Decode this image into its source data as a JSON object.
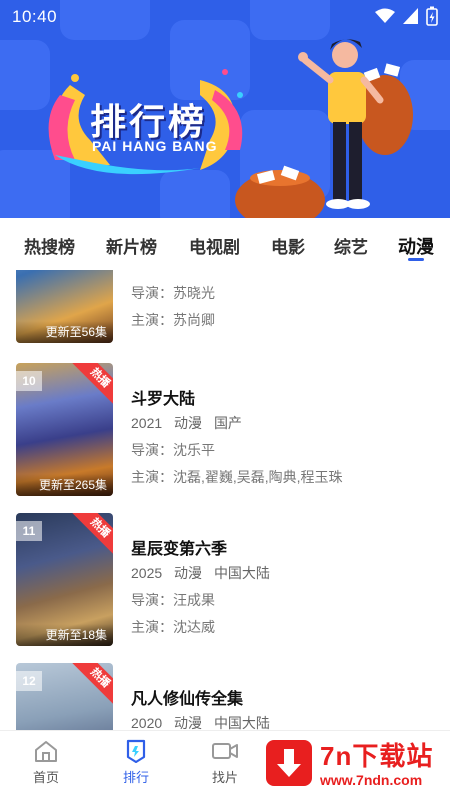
{
  "status_bar": {
    "time": "10:40"
  },
  "banner": {
    "title": "排行榜",
    "subtitle": "PAI HANG BANG"
  },
  "tabs": [
    {
      "label": "热搜榜",
      "active": false
    },
    {
      "label": "新片榜",
      "active": false
    },
    {
      "label": "电视剧",
      "active": false
    },
    {
      "label": "电影",
      "active": false
    },
    {
      "label": "综艺",
      "active": false
    },
    {
      "label": "动漫",
      "active": true
    }
  ],
  "items": [
    {
      "rank": "",
      "title": "",
      "year": "",
      "genre": "",
      "region": "",
      "director": "导演：苏晓光",
      "cast": "主演：苏尚卿",
      "update": "更新至56集",
      "hot": false
    },
    {
      "rank": "10",
      "title": "斗罗大陆",
      "year": "2021",
      "genre": "动漫",
      "region": "国产",
      "director": "导演：沈乐平",
      "cast": "主演：沈磊,翟巍,吴磊,陶典,程玉珠",
      "update": "更新至265集",
      "hot_label": "热播",
      "hot": true
    },
    {
      "rank": "11",
      "title": "星辰变第六季",
      "year": "2025",
      "genre": "动漫",
      "region": "中国大陆",
      "director": "导演：汪成果",
      "cast": "主演：沈达威",
      "update": "更新至18集",
      "hot_label": "热播",
      "hot": true
    },
    {
      "rank": "12",
      "title": "凡人修仙传全集",
      "year": "2020",
      "genre": "动漫",
      "region": "中国大陆",
      "director": "",
      "cast": "",
      "update": "",
      "hot_label": "热播",
      "hot": true
    }
  ],
  "bottom_nav": [
    {
      "label": "首页",
      "icon": "home-icon",
      "active": false
    },
    {
      "label": "排行",
      "icon": "ranking-icon",
      "active": true
    },
    {
      "label": "找片",
      "icon": "video-camera-icon",
      "active": false
    }
  ],
  "watermark": {
    "title": "7n下载站",
    "url": "www.7ndn.com",
    "icon": "download-arrow-icon"
  },
  "colors": {
    "primary": "#2f5fe8",
    "hot": "#ef3b3b",
    "watermark": "#e81f1f"
  }
}
